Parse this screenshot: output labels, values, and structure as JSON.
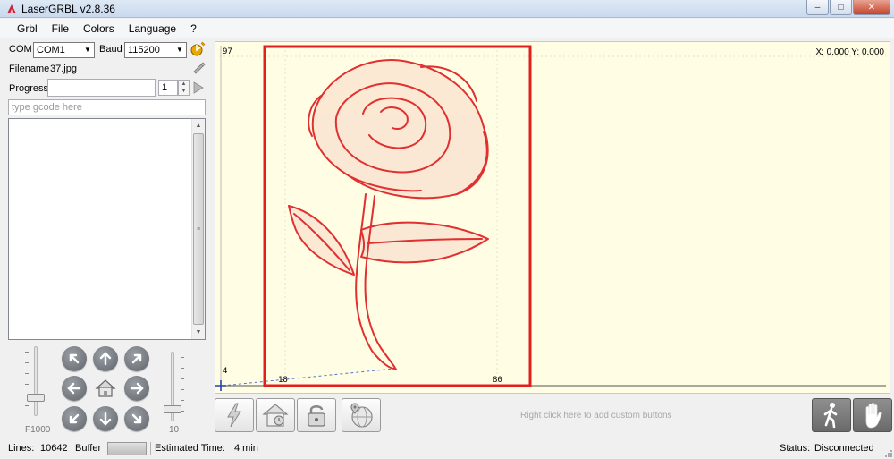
{
  "window": {
    "title": "LaserGRBL v2.8.36",
    "minimize_glyph": "–",
    "restore_glyph": "□",
    "close_glyph": "✕"
  },
  "menu": [
    "Grbl",
    "File",
    "Colors",
    "Language",
    "?"
  ],
  "connection": {
    "com_label": "COM",
    "com_value": "COM1",
    "baud_label": "Baud",
    "baud_value": "115200"
  },
  "file": {
    "filename_label": "Filename",
    "filename_value": "37.jpg"
  },
  "progress": {
    "label": "Progress",
    "copies_value": "1"
  },
  "gcode": {
    "placeholder": "type gcode here"
  },
  "jog": {
    "speed_label": "F1000",
    "step_label": "10"
  },
  "preview": {
    "coordinates": "X: 0.000 Y: 0.000",
    "y_top_label": "97",
    "y_bottom_label": "4",
    "x_left_label": "18",
    "x_right_label": "80",
    "frame_color": "#e02020",
    "background_color": "#fffde3"
  },
  "toolbar": {
    "custom_hint": "Right click here to add custom buttons"
  },
  "status": {
    "lines_label": "Lines:",
    "lines_value": "10642",
    "buffer_label": "Buffer",
    "estimated_label": "Estimated Time:",
    "estimated_value": "4 min",
    "status_label": "Status:",
    "status_value": "Disconnected"
  }
}
